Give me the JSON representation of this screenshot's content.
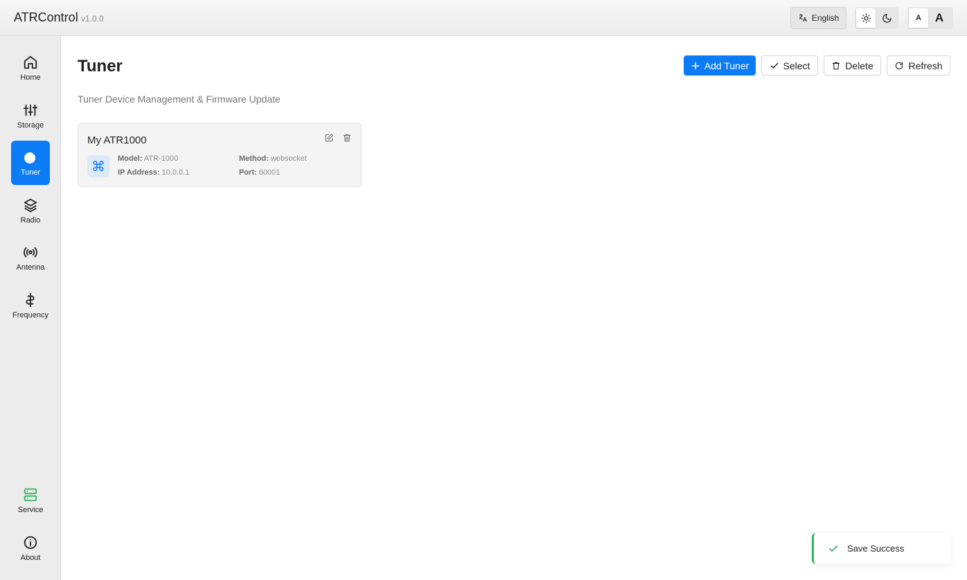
{
  "app": {
    "title": "ATRControl",
    "version": "v1.0.0"
  },
  "header": {
    "language": "English",
    "font_small": "A",
    "font_large": "A"
  },
  "sidebar": {
    "items": [
      {
        "label": "Home",
        "icon": "home-icon"
      },
      {
        "label": "Storage",
        "icon": "sliders-icon"
      },
      {
        "label": "Tuner",
        "icon": "tuner-icon",
        "active": true
      },
      {
        "label": "Radio",
        "icon": "layers-icon"
      },
      {
        "label": "Antenna",
        "icon": "antenna-icon"
      },
      {
        "label": "Frequency",
        "icon": "frequency-icon"
      },
      {
        "label": "Service",
        "icon": "server-icon"
      },
      {
        "label": "About",
        "icon": "info-icon"
      }
    ]
  },
  "main": {
    "title": "Tuner",
    "subtitle": "Tuner Device Management & Firmware Update",
    "buttons": {
      "add": "Add Tuner",
      "select": "Select",
      "delete": "Delete",
      "refresh": "Refresh"
    }
  },
  "device": {
    "name": "My ATR1000",
    "model_label": "Model:",
    "model": "ATR-1000",
    "ip_label": "IP Address:",
    "ip": "10.0.0.1",
    "method_label": "Method:",
    "method": "websocket",
    "port_label": "Port:",
    "port": "60001",
    "icon": "command-icon"
  },
  "toast": {
    "message": "Save Success",
    "status_color": "#2fb65d"
  },
  "colors": {
    "accent": "#0b7cf5",
    "success": "#2fb65d"
  }
}
